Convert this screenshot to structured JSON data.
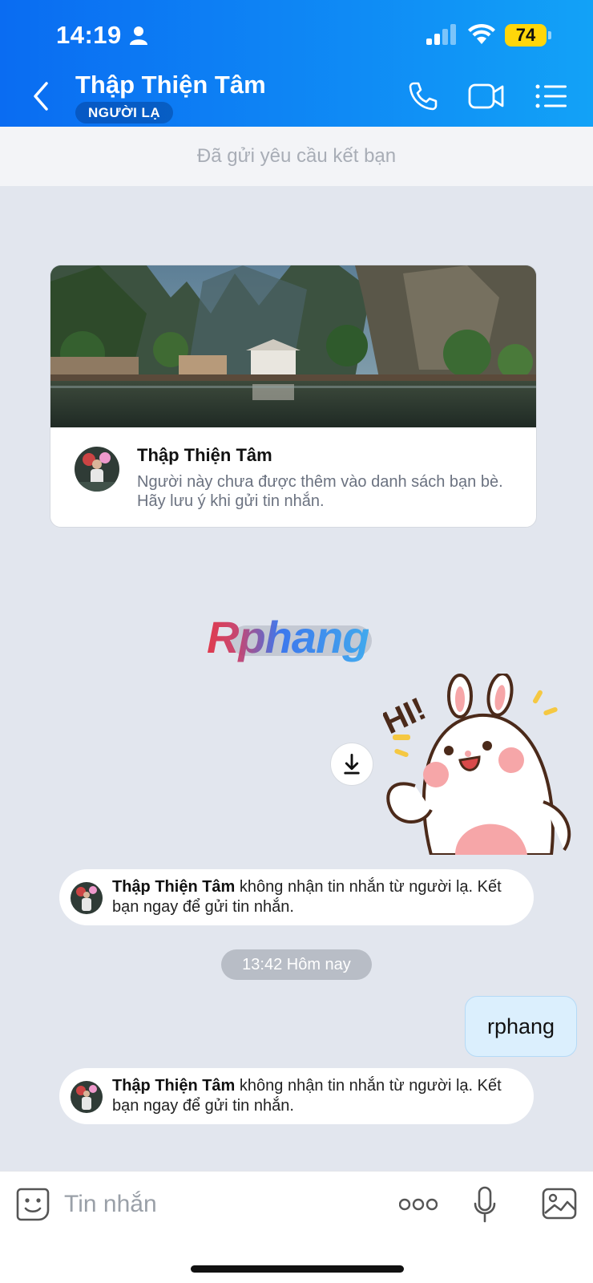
{
  "status_bar": {
    "time": "14:19",
    "battery": "74"
  },
  "header": {
    "title": "Thập Thiện Tâm",
    "badge": "NGƯỜI LẠ"
  },
  "friend_request": {
    "text": "Đã gửi yêu cầu kết bạn"
  },
  "profile_card": {
    "name": "Thập Thiện Tâm",
    "note": "Người này chưa được thêm vào danh sách bạn bè. Hãy lưu ý khi gửi tin nhắn."
  },
  "watermark": {
    "text": "Rphang"
  },
  "sticker": {
    "text": "HI!"
  },
  "notices": [
    {
      "name": "Thập Thiện Tâm",
      "text": " không nhận tin nhắn từ người lạ. Kết bạn ngay để gửi tin nhắn."
    },
    {
      "name": "Thập Thiện Tâm",
      "text": " không nhận tin nhắn từ người lạ. Kết bạn ngay để gửi tin nhắn."
    }
  ],
  "time_separator": {
    "text": "13:42 Hôm nay"
  },
  "outgoing_message": {
    "text": "rphang"
  },
  "input": {
    "placeholder": "Tin nhắn"
  },
  "colors": {
    "header_start": "#0a6cf2",
    "header_end": "#12a2f7",
    "chat_background": "#e2e6ee",
    "outgoing_bubble": "#dbeffd",
    "battery": "#ffd60a"
  }
}
